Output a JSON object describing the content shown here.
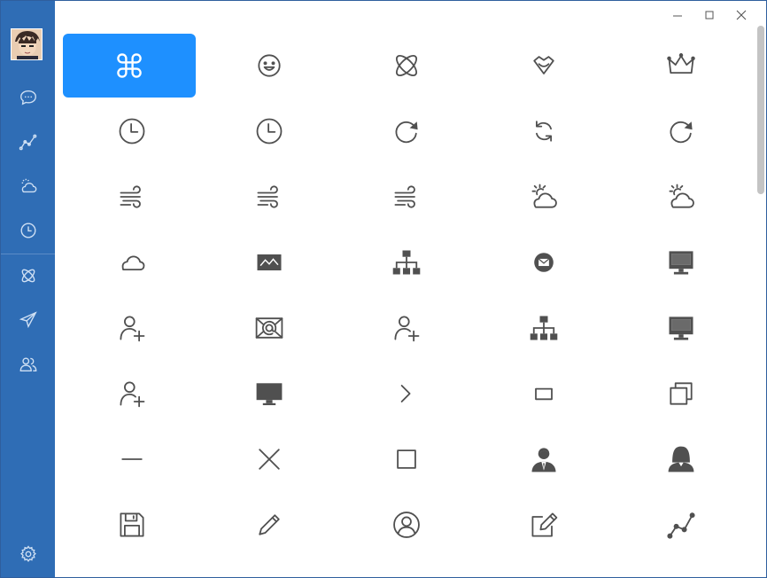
{
  "window": {
    "controls": [
      {
        "name": "minimize",
        "icon": "minimize-icon"
      },
      {
        "name": "maximize",
        "icon": "maximize-icon"
      },
      {
        "name": "close",
        "icon": "close-icon"
      }
    ]
  },
  "sidebar": {
    "bg_color": "#2f6db5",
    "items": [
      {
        "icon": "chat-bubble-icon"
      },
      {
        "icon": "line-chart-icon"
      },
      {
        "icon": "cloud-sun-icon"
      },
      {
        "icon": "clock-icon"
      },
      {
        "icon": "atom-icon"
      },
      {
        "icon": "paper-plane-icon"
      },
      {
        "icon": "users-icon"
      }
    ],
    "settings_icon": "gear-icon"
  },
  "icon_grid": {
    "selected_color": "#1e90ff",
    "icon_color": "#505050",
    "selected_index": 0,
    "icons": [
      "clover-command-icon",
      "smile-icon",
      "atom-icon",
      "heart-box-icon",
      "crown-icon",
      "clock-icon",
      "clock-icon",
      "refresh-icon",
      "sync-icon",
      "refresh-icon",
      "wind-icon",
      "wind-icon",
      "wind-icon",
      "cloud-sun-icon",
      "cloud-sun-icon",
      "cloud-icon",
      "image-icon",
      "sitemap-icon",
      "mail-circle-icon",
      "monitor-icon",
      "user-add-icon",
      "email-at-icon",
      "user-add-icon",
      "sitemap-icon",
      "monitor-icon",
      "user-add-icon",
      "desktop-icon",
      "chevron-right-icon",
      "restore-icon",
      "copy-icon",
      "minimize-icon",
      "close-icon",
      "maximize-icon",
      "user-tie-icon",
      "user-woman-icon",
      "save-icon",
      "pencil-icon",
      "user-circle-icon",
      "edit-icon",
      "line-chart-icon"
    ]
  }
}
